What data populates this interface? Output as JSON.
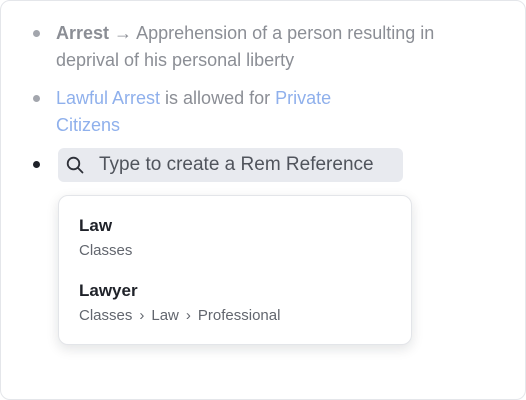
{
  "bullets": [
    {
      "term": "Arrest",
      "arrow": "→",
      "definition": "Apprehension of a person resulting in deprival of his personal liberty"
    },
    {
      "link1": "Lawful Arrest",
      "middle": " is allowed for ",
      "link2": "Private Citizens"
    }
  ],
  "search": {
    "placeholder": "Type to create a Rem Reference",
    "icon": "search-icon"
  },
  "suggestions": [
    {
      "title": "Law",
      "path": [
        "Classes"
      ]
    },
    {
      "title": "Lawyer",
      "path": [
        "Classes",
        "Law",
        "Professional"
      ]
    }
  ],
  "separator": "›",
  "colors": {
    "link": "#8fb0ec",
    "muted_text": "#8b8e95",
    "search_bg": "#e8eaef"
  }
}
